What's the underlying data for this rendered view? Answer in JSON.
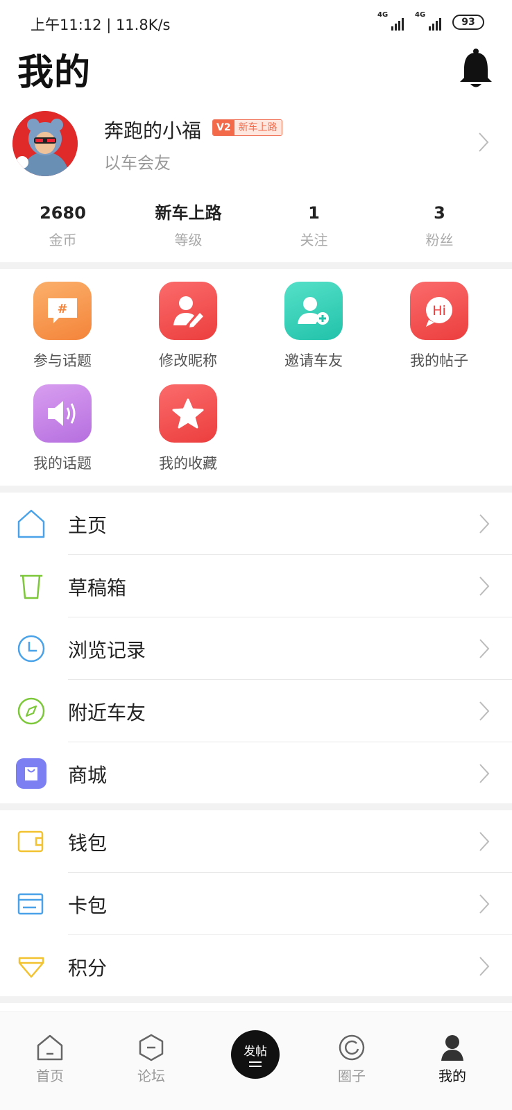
{
  "status": {
    "time": "上午11:12 | 11.8K/s",
    "net1": "4G",
    "net2": "4G",
    "battery": "93"
  },
  "header": {
    "title": "我的"
  },
  "profile": {
    "name": "奔跑的小福",
    "level_tag": "V2",
    "level_name": "新车上路",
    "motto": "以车会友"
  },
  "stats": [
    {
      "value": "2680",
      "label": "金币"
    },
    {
      "value": "新车上路",
      "label": "等级"
    },
    {
      "value": "1",
      "label": "关注"
    },
    {
      "value": "3",
      "label": "粉丝"
    }
  ],
  "grid": [
    {
      "label": "参与话题",
      "icon": "topic-icon"
    },
    {
      "label": "修改昵称",
      "icon": "edit-name-icon"
    },
    {
      "label": "邀请车友",
      "icon": "invite-friend-icon"
    },
    {
      "label": "我的帖子",
      "icon": "hi-icon",
      "glyph": "Hi"
    },
    {
      "label": "我的话题",
      "icon": "speaker-icon"
    },
    {
      "label": "我的收藏",
      "icon": "star-icon"
    }
  ],
  "menu": [
    {
      "label": "主页",
      "icon": "home-icon"
    },
    {
      "label": "草稿箱",
      "icon": "bin-icon"
    },
    {
      "label": "浏览记录",
      "icon": "clock-icon"
    },
    {
      "label": "附近车友",
      "icon": "compass-icon"
    },
    {
      "label": "商城",
      "icon": "shop-icon"
    },
    {
      "label": "钱包",
      "icon": "wallet-icon"
    },
    {
      "label": "卡包",
      "icon": "card-icon"
    },
    {
      "label": "积分",
      "icon": "points-icon"
    }
  ],
  "tabs": [
    {
      "label": "首页",
      "icon": "home-tab-icon"
    },
    {
      "label": "论坛",
      "icon": "forum-tab-icon"
    },
    {
      "label": "发帖",
      "icon": "post-icon"
    },
    {
      "label": "圈子",
      "icon": "circle-tab-icon"
    },
    {
      "label": "我的",
      "icon": "profile-tab-icon",
      "active": true
    }
  ]
}
